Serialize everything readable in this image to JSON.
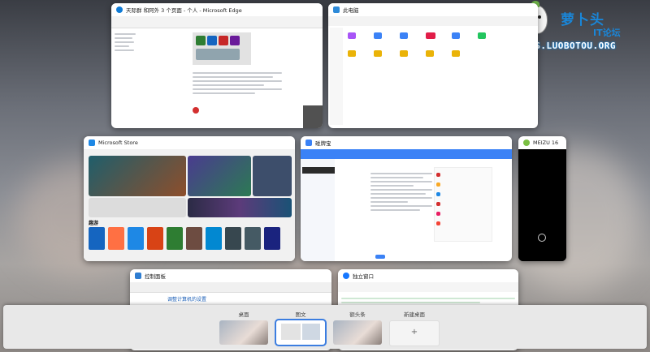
{
  "windows": {
    "edge": {
      "title": "天际群 和阿外 3 个页面 - 个人 - Microsoft Edge",
      "icon_color": "#0f7bd6"
    },
    "explorer": {
      "title": "此电脑",
      "icon_color": "#2d8ad9"
    },
    "store": {
      "title": "Microsoft Store",
      "icon_color": "#1e88e5",
      "section_label": "趣游"
    },
    "app": {
      "title": "碰牌宝",
      "icon_color": "#3b82f6"
    },
    "phone": {
      "title": "MEIZU 16",
      "icon_color": "#7bc043"
    },
    "control": {
      "title": "控制面板",
      "icon_color": "#2e7dd1",
      "heading": "调整计算机的设置"
    },
    "ding": {
      "title": "独立窗口",
      "icon_color": "#1677ff"
    }
  },
  "logo": {
    "name": "萝卜头",
    "sub": "IT论坛",
    "url": "BBS.LUOBOTOU.ORG"
  },
  "desktops": [
    {
      "label": "桌面",
      "active": false
    },
    {
      "label": "图文",
      "active": true
    },
    {
      "label": "额头条",
      "active": false
    },
    {
      "label": "新建桌面",
      "active": false
    }
  ],
  "new_desktop_symbol": "+"
}
